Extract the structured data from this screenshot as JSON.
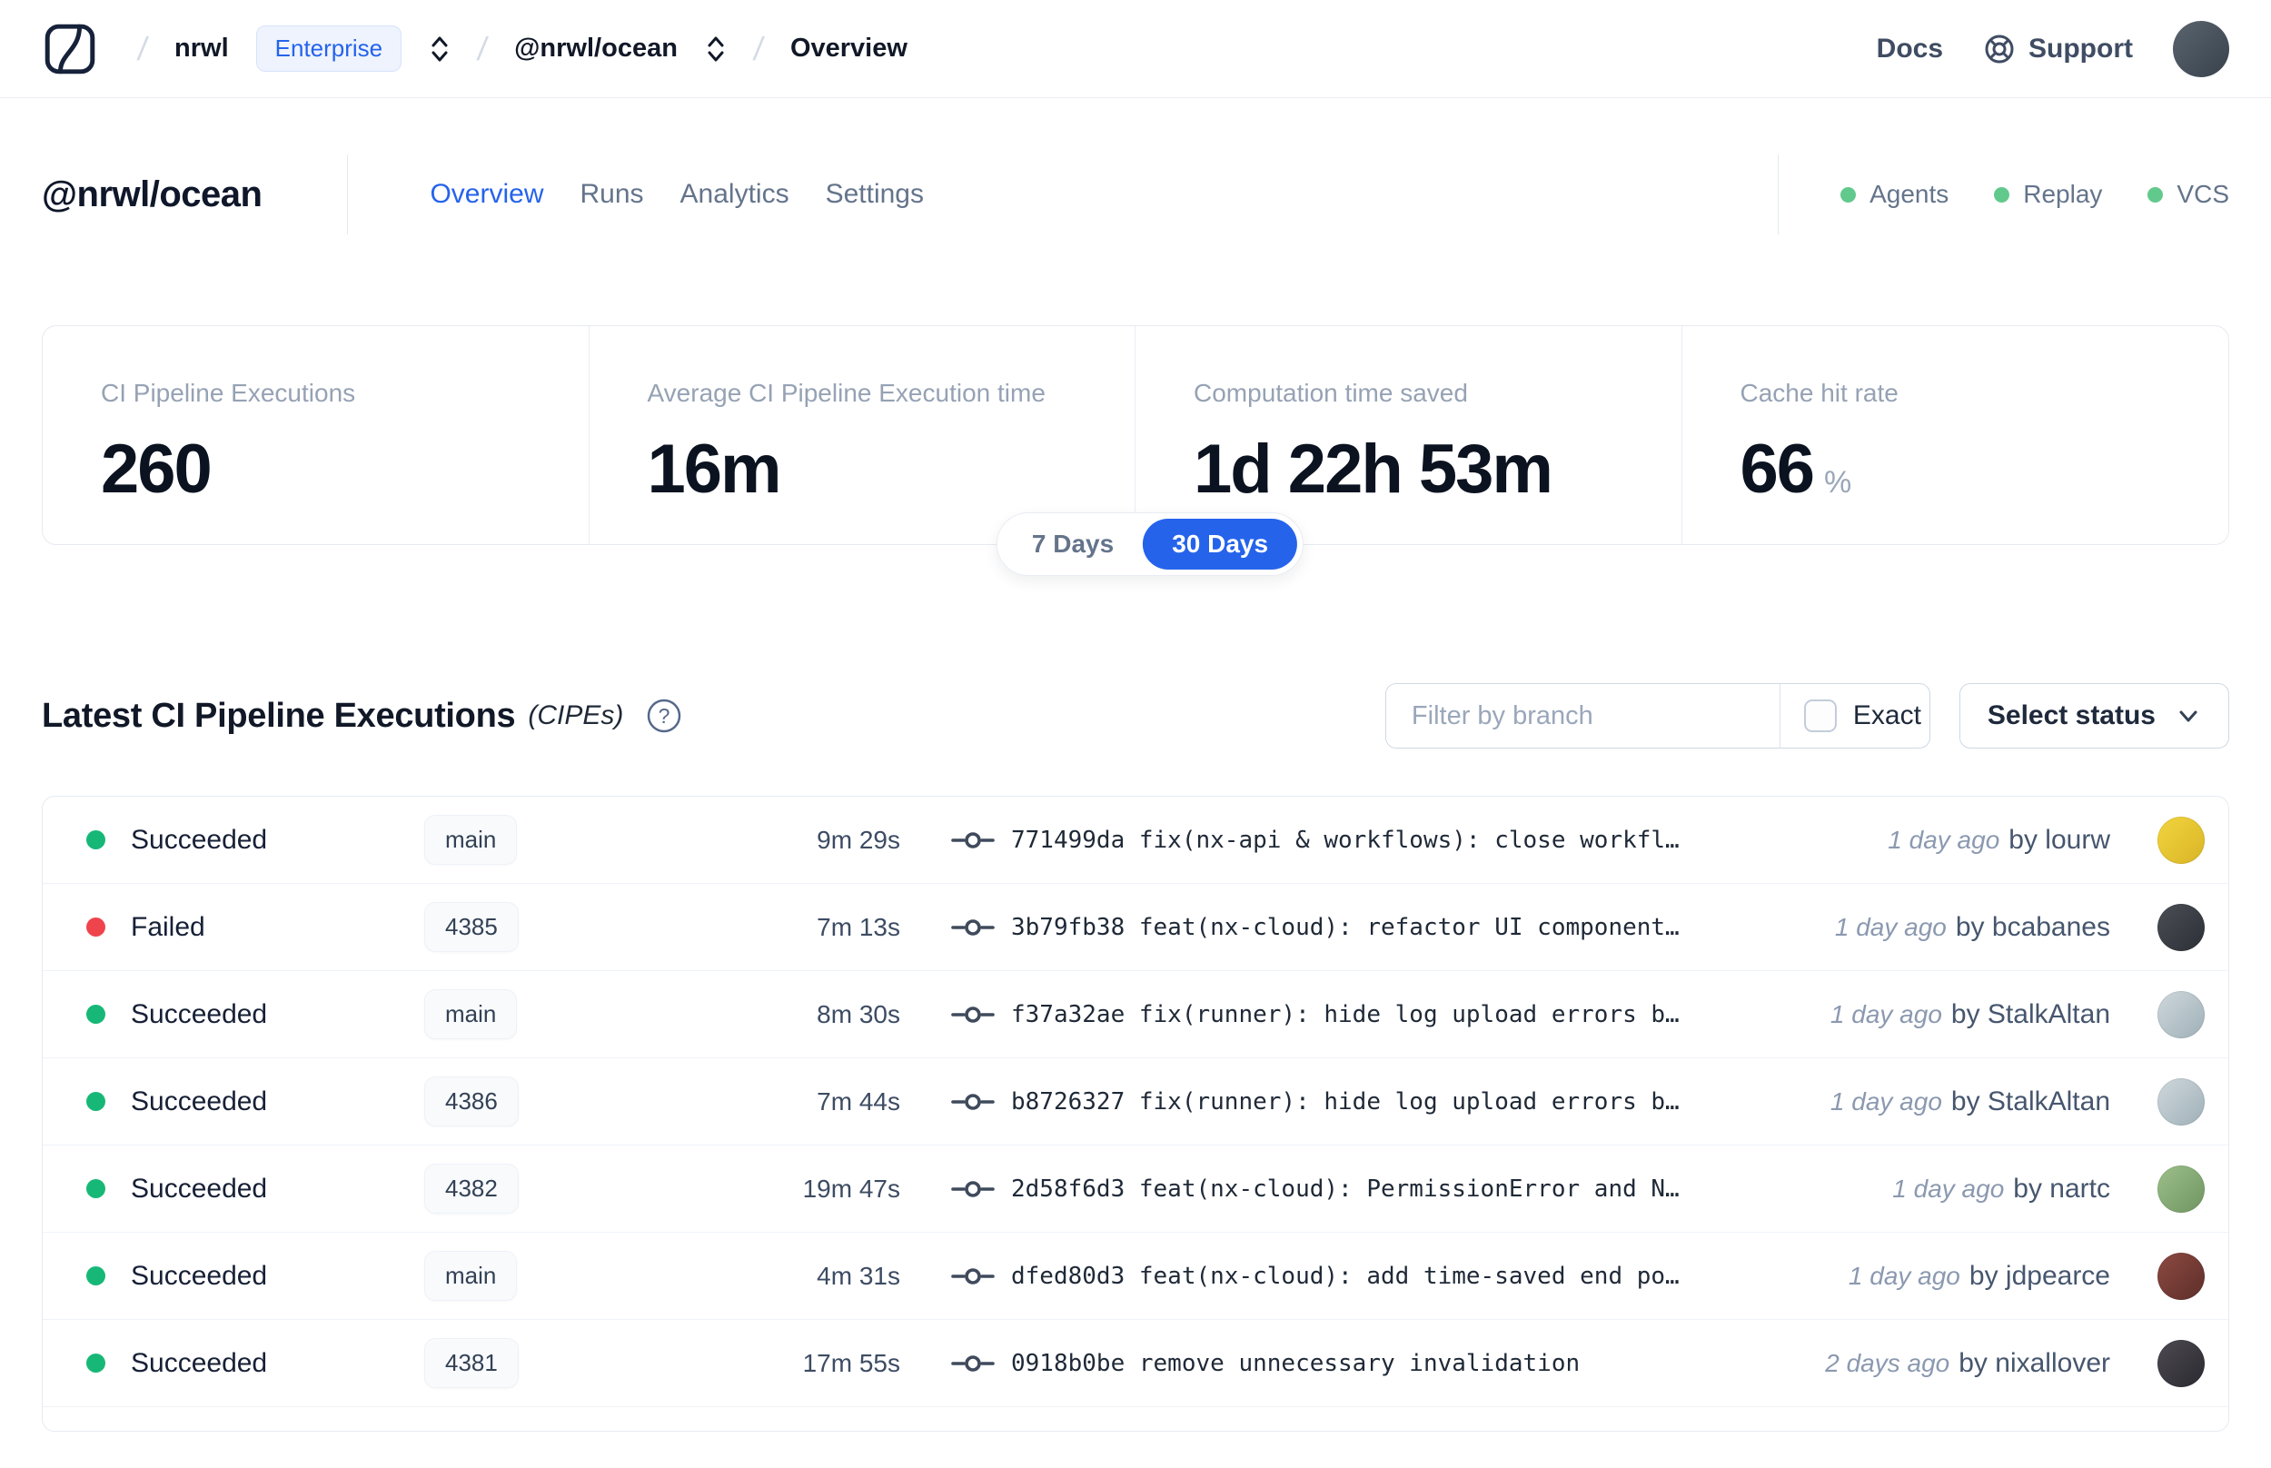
{
  "nav": {
    "org": "nrwl",
    "org_badge": "Enterprise",
    "workspace": "@nrwl/ocean",
    "page": "Overview",
    "docs_label": "Docs",
    "support_label": "Support",
    "avatar_color": "linear-gradient(135deg,#5a646e,#39424c)"
  },
  "header": {
    "title": "@nrwl/ocean",
    "tabs": [
      {
        "label": "Overview"
      },
      {
        "label": "Runs"
      },
      {
        "label": "Analytics"
      },
      {
        "label": "Settings"
      }
    ],
    "flags": [
      {
        "label": "Agents"
      },
      {
        "label": "Replay"
      },
      {
        "label": "VCS"
      }
    ],
    "flag_color": "#62c98c"
  },
  "stats": {
    "cards": [
      {
        "label": "CI Pipeline Executions",
        "value": "260",
        "suffix": ""
      },
      {
        "label": "Average CI Pipeline Execution time",
        "value": "16m",
        "suffix": ""
      },
      {
        "label": "Computation time saved",
        "value": "1d 22h 53m",
        "suffix": ""
      },
      {
        "label": "Cache hit rate",
        "value": "66",
        "suffix": "%"
      }
    ],
    "range": {
      "option_7": "7 Days",
      "option_30": "30 Days",
      "selected": "30 Days"
    }
  },
  "cipe": {
    "title": "Latest CI Pipeline Executions",
    "title_suffix": "(CIPEs)",
    "filter_placeholder": "Filter by branch",
    "exact_label": "Exact",
    "status_select_label": "Select status",
    "rows": [
      {
        "status": "Succeeded",
        "status_color": "#17b877",
        "branch": "main",
        "duration": "9m 29s",
        "commit": "771499da fix(nx-api & workflows): close workfl…",
        "time": "1 day ago",
        "author": "by lourw",
        "avatar_color": "linear-gradient(135deg,#f2d540,#d9b425)"
      },
      {
        "status": "Failed",
        "status_color": "#f0444c",
        "branch": "4385",
        "duration": "7m 13s",
        "commit": "3b79fb38 feat(nx-cloud): refactor UI component…",
        "time": "1 day ago",
        "author": "by bcabanes",
        "avatar_color": "linear-gradient(135deg,#4a4f55,#2c3036)"
      },
      {
        "status": "Succeeded",
        "status_color": "#17b877",
        "branch": "main",
        "duration": "8m 30s",
        "commit": "f37a32ae fix(runner): hide log upload errors b…",
        "time": "1 day ago",
        "author": "by StalkAltan",
        "avatar_color": "linear-gradient(135deg,#cfd8dc,#9fb0b8)"
      },
      {
        "status": "Succeeded",
        "status_color": "#17b877",
        "branch": "4386",
        "duration": "7m 44s",
        "commit": "b8726327 fix(runner): hide log upload errors b…",
        "time": "1 day ago",
        "author": "by StalkAltan",
        "avatar_color": "linear-gradient(135deg,#cfd8dc,#9fb0b8)"
      },
      {
        "status": "Succeeded",
        "status_color": "#17b877",
        "branch": "4382",
        "duration": "19m 47s",
        "commit": "2d58f6d3 feat(nx-cloud): PermissionError and N…",
        "time": "1 day ago",
        "author": "by nartc",
        "avatar_color": "linear-gradient(135deg,#9dc08b,#6f9460)"
      },
      {
        "status": "Succeeded",
        "status_color": "#17b877",
        "branch": "main",
        "duration": "4m 31s",
        "commit": "dfed80d3 feat(nx-cloud): add time-saved end po…",
        "time": "1 day ago",
        "author": "by jdpearce",
        "avatar_color": "linear-gradient(135deg,#8c4a42,#5e2e29)"
      },
      {
        "status": "Succeeded",
        "status_color": "#17b877",
        "branch": "4381",
        "duration": "17m 55s",
        "commit": "0918b0be remove unnecessary invalidation",
        "time": "2 days ago",
        "author": "by nixallover",
        "avatar_color": "linear-gradient(135deg,#4d4a52,#2b2930)"
      }
    ]
  },
  "colors": {
    "accent": "#2563eb",
    "success": "#17b877",
    "failed": "#f0444c"
  }
}
